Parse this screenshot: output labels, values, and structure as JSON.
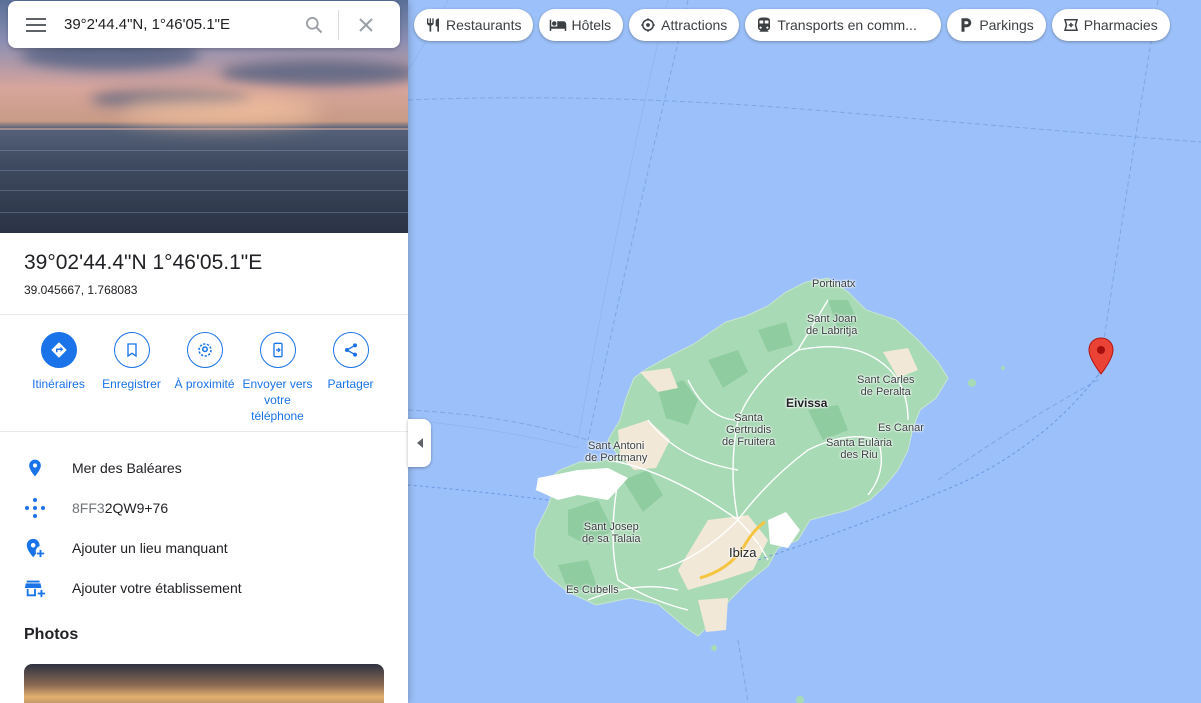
{
  "search": {
    "query": "39°2'44.4\"N, 1°46'05.1\"E"
  },
  "chips": [
    {
      "label": "Restaurants",
      "icon": "restaurant-icon"
    },
    {
      "label": "Hôtels",
      "icon": "hotel-icon"
    },
    {
      "label": "Attractions",
      "icon": "attractions-icon"
    },
    {
      "label": "Transports en comm...",
      "icon": "transit-icon"
    },
    {
      "label": "Parkings",
      "icon": "parking-icon"
    },
    {
      "label": "Pharmacies",
      "icon": "pharmacy-icon"
    }
  ],
  "place": {
    "title": "39°02'44.4\"N 1°46'05.1\"E",
    "decimal": "39.045667, 1.768083"
  },
  "actions": [
    {
      "label": "Itinéraires",
      "icon": "directions-icon"
    },
    {
      "label": "Enregistrer",
      "icon": "bookmark-icon"
    },
    {
      "label": "À proximité",
      "icon": "nearby-icon"
    },
    {
      "label": "Envoyer vers votre téléphone",
      "icon": "send-to-phone-icon"
    },
    {
      "label": "Partager",
      "icon": "share-icon"
    }
  ],
  "info": {
    "region": "Mer des Baléares",
    "plus_code_prefix": "8FF3",
    "plus_code_rest": "2QW9+76",
    "add_place": "Ajouter un lieu manquant",
    "add_business": "Ajouter votre établissement"
  },
  "photos": {
    "title": "Photos"
  },
  "map": {
    "water_color": "#9cc0f9",
    "land_color": "#a8dab5",
    "pin_color": "#ea4335",
    "labels": {
      "portinatx": "Portinatx",
      "sant_joan": "Sant Joan\nde Labritja",
      "sant_carles": "Sant Carles\nde Peralta",
      "eivissa": "Eivissa",
      "santa_gertrudis": "Santa\nGertrudis\nde Fruitera",
      "es_canar": "Es Canar",
      "sant_antoni": "Sant Antoni\nde Portmany",
      "santa_eularia": "Santa Eulària\ndes Riu",
      "sant_josep": "Sant Josep\nde sa Talaia",
      "ibiza": "Ibiza",
      "es_cubells": "Es Cubells"
    }
  }
}
